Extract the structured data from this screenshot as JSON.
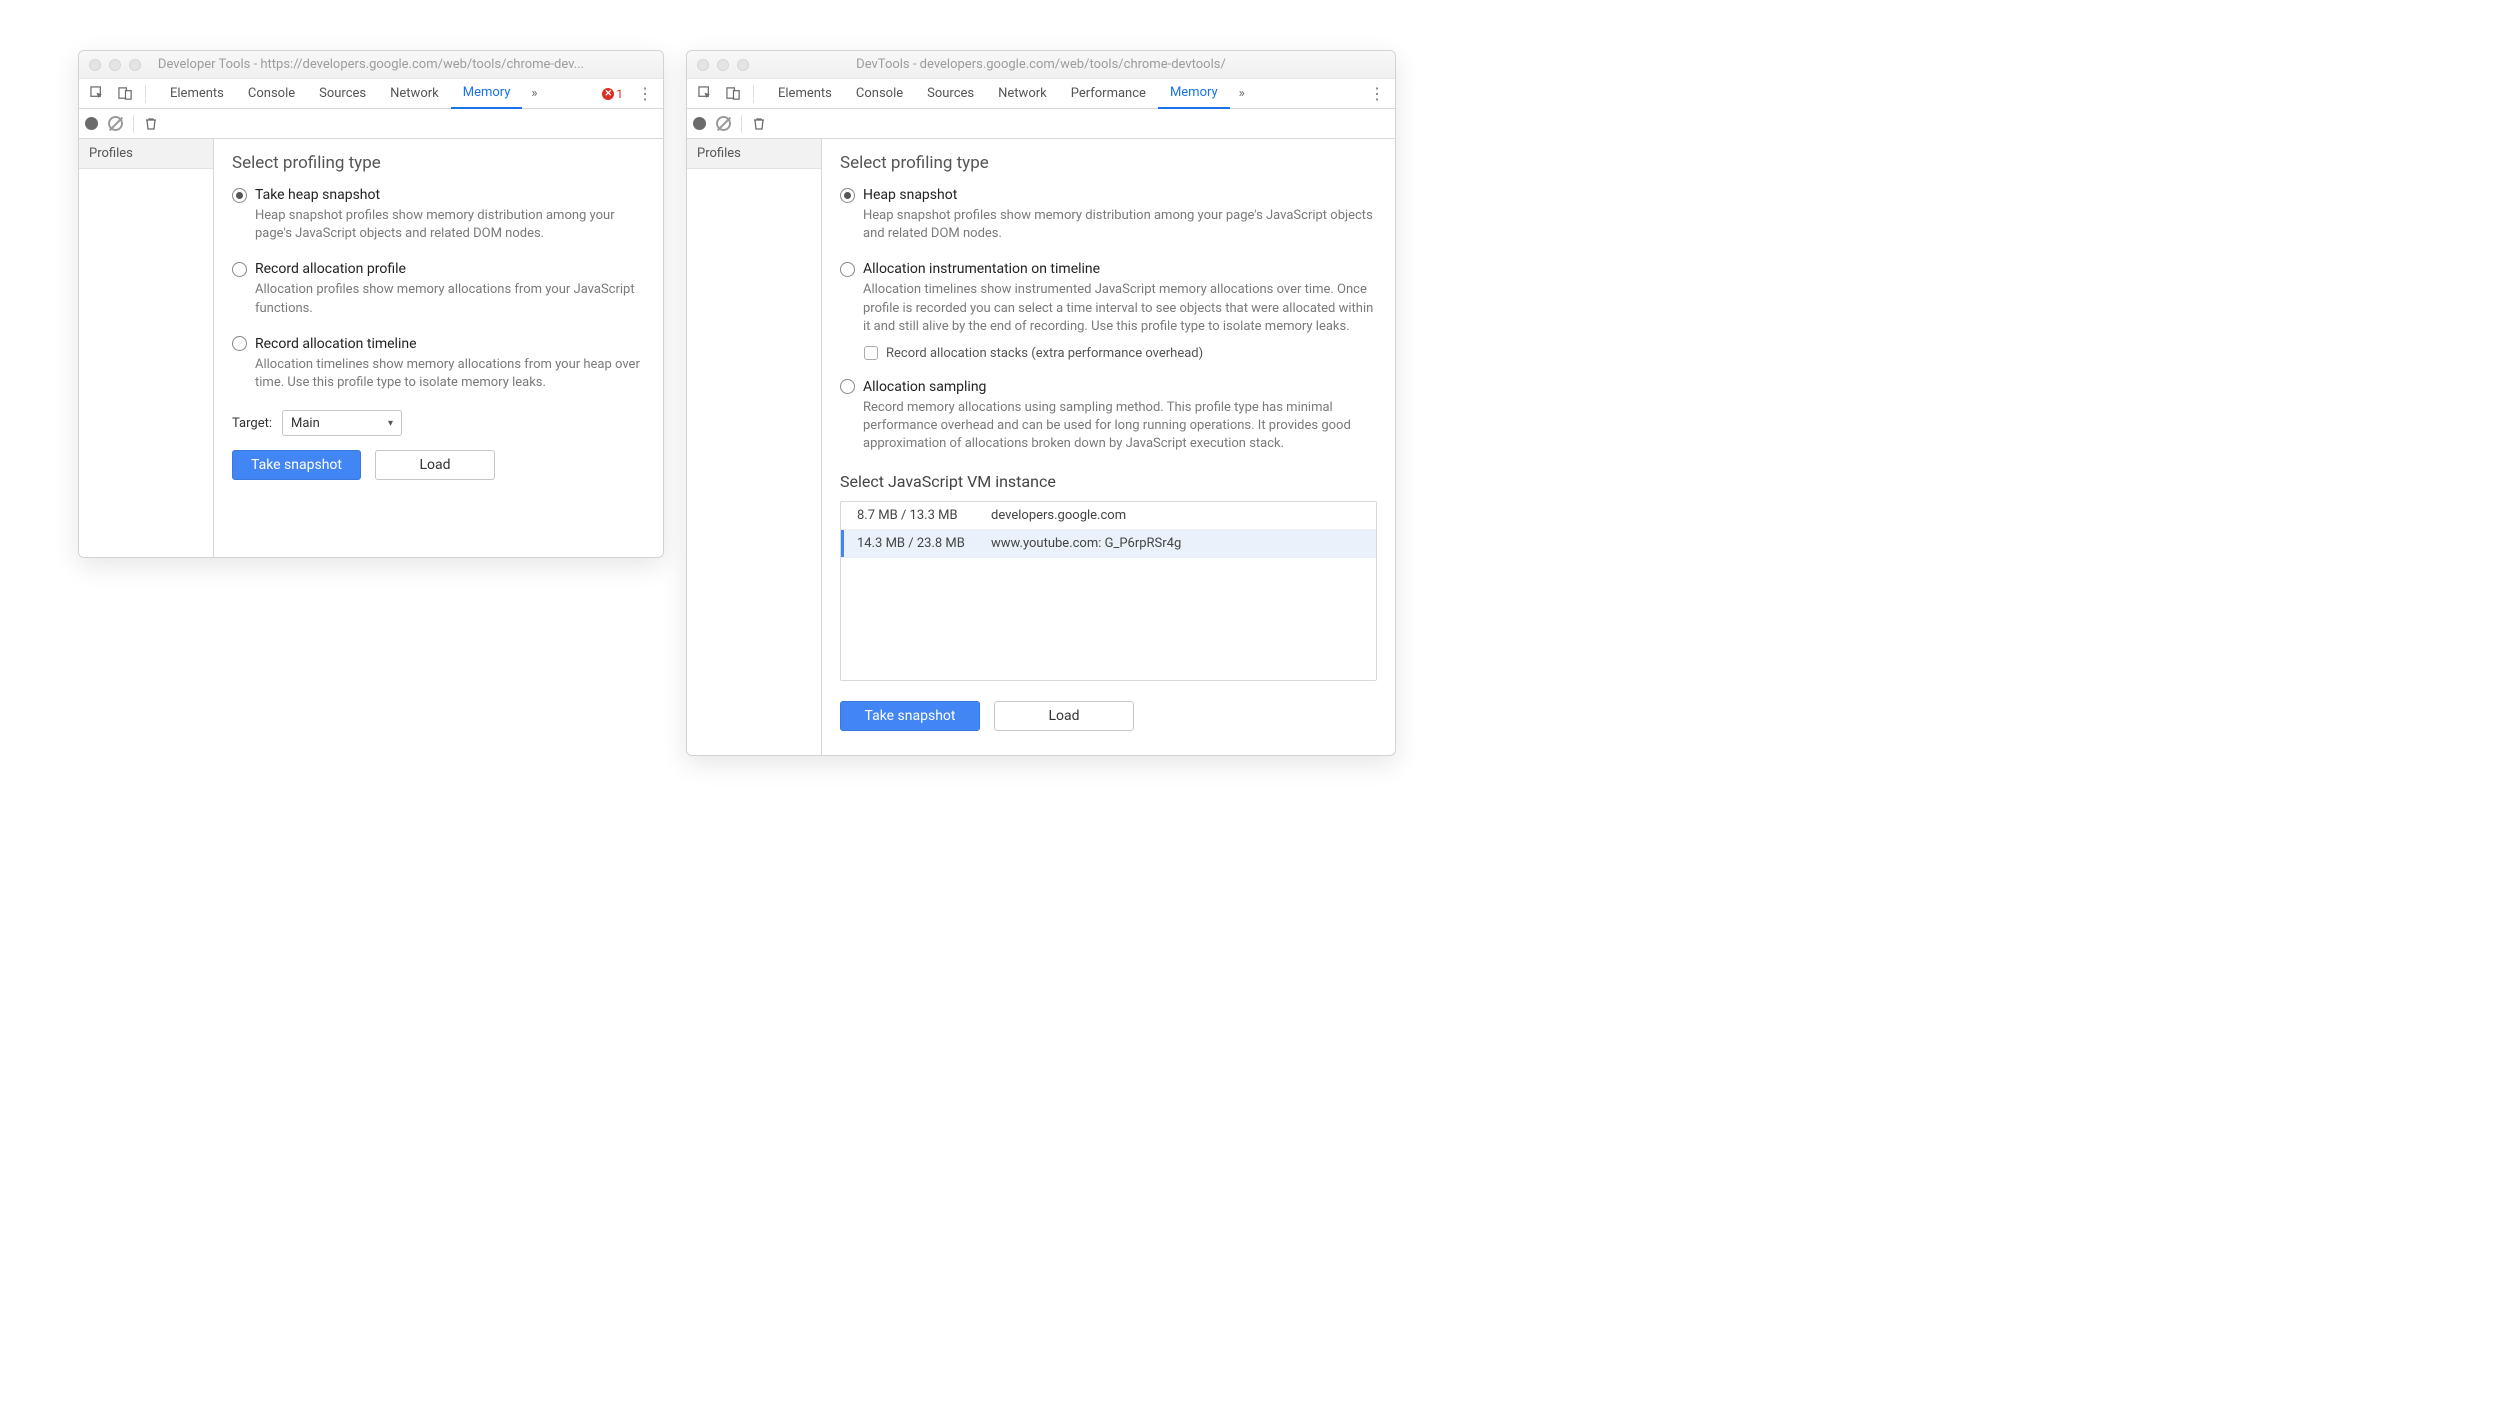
{
  "left": {
    "title": "Developer Tools - https://developers.google.com/web/tools/chrome-dev...",
    "tabs": [
      "Elements",
      "Console",
      "Sources",
      "Network",
      "Memory"
    ],
    "active_tab": "Memory",
    "error_count": "1",
    "sidebar": {
      "section": "Profiles"
    },
    "heading": "Select profiling type",
    "opts": [
      {
        "title": "Take heap snapshot",
        "desc": "Heap snapshot profiles show memory distribution among your page's JavaScript objects and related DOM nodes.",
        "selected": true
      },
      {
        "title": "Record allocation profile",
        "desc": "Allocation profiles show memory allocations from your JavaScript functions.",
        "selected": false
      },
      {
        "title": "Record allocation timeline",
        "desc": "Allocation timelines show memory allocations from your heap over time. Use this profile type to isolate memory leaks.",
        "selected": false
      }
    ],
    "target_label": "Target:",
    "target_value": "Main",
    "primary_btn": "Take snapshot",
    "secondary_btn": "Load"
  },
  "right": {
    "title": "DevTools - developers.google.com/web/tools/chrome-devtools/",
    "tabs": [
      "Elements",
      "Console",
      "Sources",
      "Network",
      "Performance",
      "Memory"
    ],
    "active_tab": "Memory",
    "sidebar": {
      "section": "Profiles"
    },
    "heading": "Select profiling type",
    "opts": [
      {
        "title": "Heap snapshot",
        "desc": "Heap snapshot profiles show memory distribution among your page's JavaScript objects and related DOM nodes.",
        "selected": true
      },
      {
        "title": "Allocation instrumentation on timeline",
        "desc": "Allocation timelines show instrumented JavaScript memory allocations over time. Once profile is recorded you can select a time interval to see objects that were allocated within it and still alive by the end of recording. Use this profile type to isolate memory leaks.",
        "selected": false,
        "sub_checkbox_label": "Record allocation stacks (extra performance overhead)"
      },
      {
        "title": "Allocation sampling",
        "desc": "Record memory allocations using sampling method. This profile type has minimal performance overhead and can be used for long running operations. It provides good approximation of allocations broken down by JavaScript execution stack.",
        "selected": false
      }
    ],
    "vm_heading": "Select JavaScript VM instance",
    "vm_rows": [
      {
        "mem": "8.7 MB / 13.3 MB",
        "host": "developers.google.com",
        "selected": false
      },
      {
        "mem": "14.3 MB / 23.8 MB",
        "host": "www.youtube.com: G_P6rpRSr4g",
        "selected": true
      }
    ],
    "primary_btn": "Take snapshot",
    "secondary_btn": "Load"
  }
}
